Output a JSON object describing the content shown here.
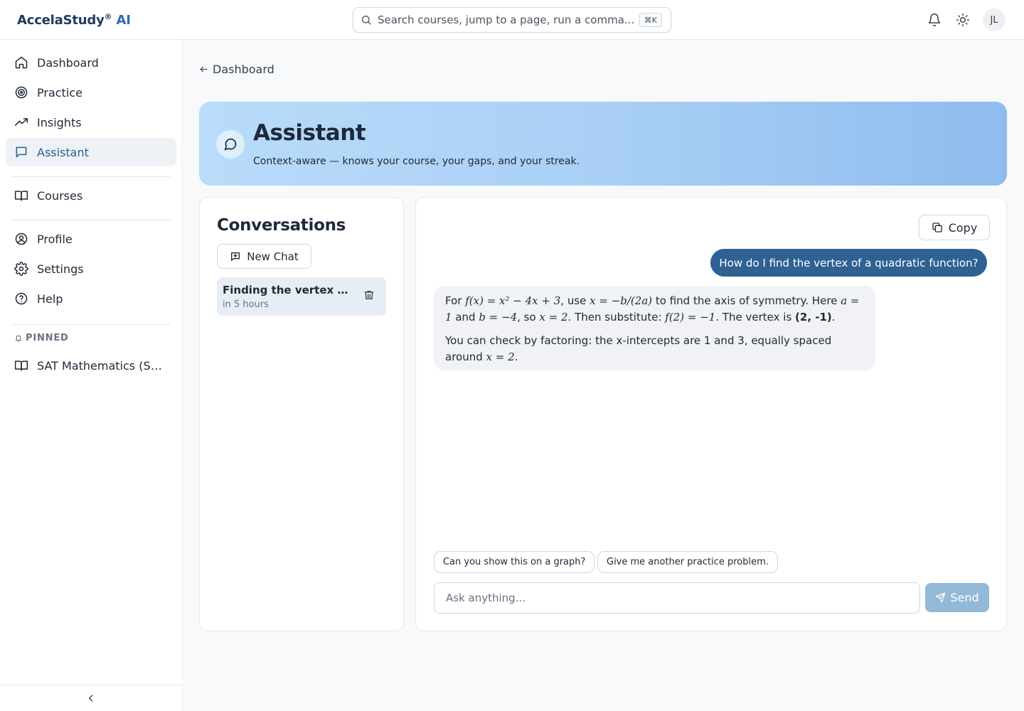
{
  "app": {
    "brand": "AccelaStudy",
    "brand_mark": "®",
    "brand_ai": "AI"
  },
  "topbar": {
    "search_placeholder": "Search courses, jump to a page, run a comma...",
    "search_shortcut": "⌘K",
    "avatar_initials": "JL",
    "icons": [
      "bell-icon",
      "sun-icon"
    ]
  },
  "sidebar": {
    "items": [
      {
        "label": "Dashboard",
        "icon": "home-icon"
      },
      {
        "label": "Practice",
        "icon": "target-icon"
      },
      {
        "label": "Insights",
        "icon": "trending-up-icon"
      },
      {
        "label": "Assistant",
        "icon": "chat-icon",
        "active": true
      },
      {
        "label": "Courses",
        "icon": "book-icon"
      },
      {
        "label": "Profile",
        "icon": "user-circle-icon"
      },
      {
        "label": "Settings",
        "icon": "gear-icon"
      },
      {
        "label": "Help",
        "icon": "help-icon"
      }
    ],
    "pinned_label": "PINNED",
    "pinned_items": [
      {
        "label": "SAT Mathematics (SAT...",
        "icon": "book-icon"
      }
    ]
  },
  "breadcrumb": {
    "back_label": "Dashboard"
  },
  "hero": {
    "title": "Assistant",
    "subtitle": "Context-aware — knows your course, your gaps, and your streak.",
    "accent": "#a9cff5"
  },
  "conversations": {
    "title": "Conversations",
    "new_chat_label": "New Chat",
    "items": [
      {
        "title": "Finding the vertex of a...",
        "time": "in 5 hours"
      }
    ]
  },
  "chat": {
    "copy_label": "Copy",
    "user_message": "How do I find the vertex of a quadratic function?",
    "assistant": {
      "p1_a": "For ",
      "p1_m1": "f(x) = x² − 4x + 3",
      "p1_b": ", use ",
      "p1_m2": "x = −b/(2a)",
      "p1_c": " to find the axis of symmetry. Here ",
      "p1_m3": "a = 1",
      "p1_d": " and ",
      "p1_m4": "b = −4",
      "p1_e": ", so ",
      "p1_m5": "x = 2",
      "p1_f": ". Then substitute: ",
      "p1_m6": "f(2) = −1",
      "p1_g": ". The vertex is ",
      "p1_bold": "(2, -1)",
      "p1_h": ".",
      "p2_a": "You can check by factoring: the x-intercepts are 1 and 3, equally spaced around ",
      "p2_m1": "x = 2",
      "p2_b": "."
    },
    "suggestions": [
      "Can you show this on a graph?",
      "Give me another practice problem."
    ],
    "input_placeholder": "Ask anything...",
    "send_label": "Send",
    "user_bubble_color": "#2f6193",
    "send_color": "#93b8d8"
  }
}
